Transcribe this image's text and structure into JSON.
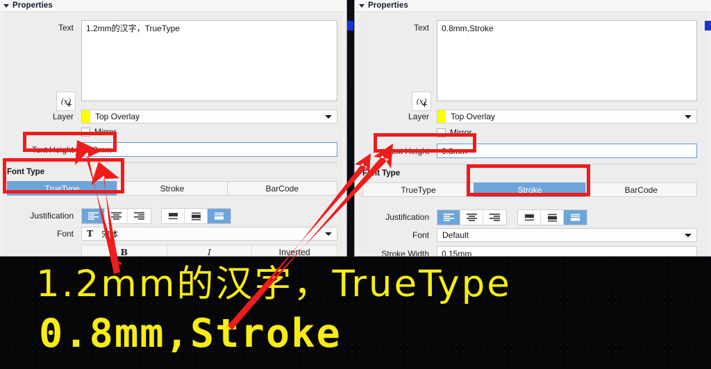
{
  "colors": {
    "accent_selected": "#6ea5d8",
    "annotation_red": "#ee1c1c",
    "pcb_text_yellow": "#f7ed12",
    "pcb_background": "#060608",
    "layer_swatch": "#ffff00",
    "focus_border": "#5b9bd5"
  },
  "left_panel": {
    "header": {
      "title": "Properties",
      "collapse_icon": "triangle-collapse-icon"
    },
    "text": {
      "label": "Text",
      "value": "1.2mm的汉字，TrueType",
      "fx_button": {
        "label": "(x)",
        "plus": "+",
        "icon": "add-parameter-icon"
      }
    },
    "layer": {
      "label": "Layer",
      "value": "Top Overlay",
      "caret_icon": "chevron-down-icon"
    },
    "mirror": {
      "label": "Mirror",
      "checked": false
    },
    "text_height": {
      "label": "Text Height",
      "value": "1.2mm"
    },
    "font_type": {
      "section_label": "Font Type",
      "options": [
        "TrueType",
        "Stroke",
        "BarCode"
      ],
      "selected": "TrueType"
    },
    "justification": {
      "label": "Justification",
      "horizontal": {
        "options": [
          "align-left-icon",
          "align-center-icon",
          "align-right-icon"
        ],
        "selected_index": 0
      },
      "vertical": {
        "options": [
          "align-top-icon",
          "align-middle-icon",
          "align-bottom-icon"
        ],
        "selected_index": 2
      }
    },
    "font": {
      "label": "Font",
      "value": "宋体",
      "icon": "truetype-font-icon",
      "caret_icon": "chevron-down-icon"
    },
    "style_buttons": [
      {
        "label": "B",
        "name": "bold-button"
      },
      {
        "label": "I",
        "name": "italic-button"
      },
      {
        "label": "Inverted",
        "name": "inverted-button"
      }
    ]
  },
  "right_panel": {
    "header": {
      "title": "Properties",
      "collapse_icon": "triangle-collapse-icon"
    },
    "text": {
      "label": "Text",
      "value": "0.8mm,Stroke",
      "fx_button": {
        "label": "(x)",
        "plus": "+",
        "icon": "add-parameter-icon"
      }
    },
    "layer": {
      "label": "Layer",
      "value": "Top Overlay",
      "caret_icon": "chevron-down-icon"
    },
    "mirror": {
      "label": "Mirror",
      "checked": false
    },
    "text_height": {
      "label": "Text Height",
      "value": "0.8mm"
    },
    "font_type": {
      "section_label": "Font Type",
      "options": [
        "TrueType",
        "Stroke",
        "BarCode"
      ],
      "selected": "Stroke"
    },
    "justification": {
      "label": "Justification",
      "horizontal": {
        "options": [
          "align-left-icon",
          "align-center-icon",
          "align-right-icon"
        ],
        "selected_index": 0
      },
      "vertical": {
        "options": [
          "align-top-icon",
          "align-middle-icon",
          "align-bottom-icon"
        ],
        "selected_index": 2
      }
    },
    "font": {
      "label": "Font",
      "value": "Default",
      "caret_icon": "chevron-down-icon"
    },
    "stroke_width": {
      "label": "Stroke Width",
      "value": "0.15mm"
    }
  },
  "pcb_preview": {
    "line1": "1.2mm的汉字，TrueType",
    "line2": "0.8mm,Stroke"
  },
  "annotations": {
    "highlight_boxes": [
      {
        "name": "text-height-highlight-left",
        "target": "Text Height 1.2mm"
      },
      {
        "name": "font-type-highlight-left",
        "target": "Font Type TrueType"
      },
      {
        "name": "text-height-highlight-right",
        "target": "Text Height 0.8mm"
      },
      {
        "name": "font-type-highlight-right",
        "target": "Font Type Stroke"
      }
    ],
    "arrows": [
      {
        "name": "arrow-to-text-height-left",
        "from": "pcb line1 text",
        "to": "Text Height 1.2mm field"
      },
      {
        "name": "arrow-to-text-height-right",
        "from": "pcb line2 text",
        "to": "Text Height 0.8mm field"
      }
    ]
  }
}
